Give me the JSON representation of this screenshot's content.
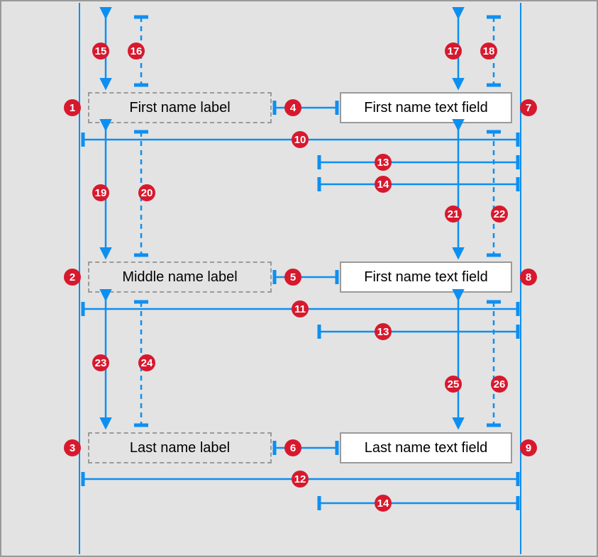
{
  "diagram": {
    "rows": [
      {
        "label": "First name label",
        "field": "First name text field"
      },
      {
        "label": "Middle name label",
        "field": "First name text field"
      },
      {
        "label": "Last name label",
        "field": "Last name text field"
      }
    ],
    "callouts": {
      "c1": "1",
      "c2": "2",
      "c3": "3",
      "c4": "4",
      "c5": "5",
      "c6": "6",
      "c7": "7",
      "c8": "8",
      "c9": "9",
      "c10": "10",
      "c11": "11",
      "c12": "12",
      "c13a": "13",
      "c13b": "13",
      "c14a": "14",
      "c14b": "14",
      "c15": "15",
      "c16": "16",
      "c17": "17",
      "c18": "18",
      "c19": "19",
      "c20": "20",
      "c21": "21",
      "c22": "22",
      "c23": "23",
      "c24": "24",
      "c25": "25",
      "c26": "26"
    },
    "colors": {
      "blue": "#0d8ff2",
      "red": "#d7192e",
      "gray": "#9a9a9a",
      "bg": "#e3e3e3"
    }
  }
}
